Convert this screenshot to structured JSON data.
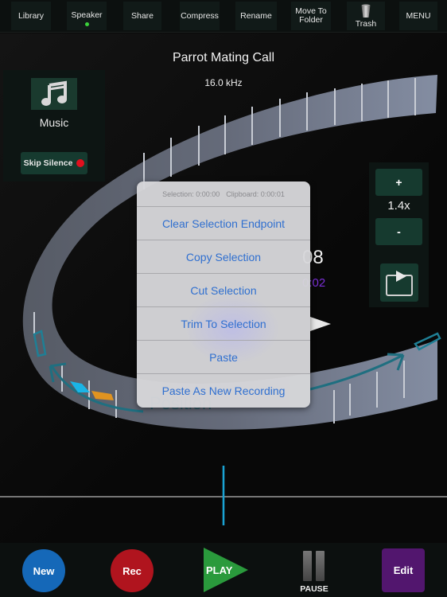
{
  "toolbar": {
    "buttons": [
      {
        "label": "Library"
      },
      {
        "label": "Speaker",
        "active_indicator": true
      },
      {
        "label": "Share"
      },
      {
        "label": "Compress"
      },
      {
        "label": "Rename"
      },
      {
        "label": "Move To Folder",
        "line1": "Move To",
        "line2": "Folder"
      },
      {
        "label": "Trash",
        "icon": "trash-icon"
      },
      {
        "label": "MENU"
      }
    ],
    "indicator_color": "#3bd13b"
  },
  "recording": {
    "title": "Parrot Mating Call",
    "sample_rate": "16.0 kHz"
  },
  "left_panel": {
    "category_icon": "music-note-icon",
    "category_label": "Music",
    "skip_silence_label": "Skip Silence",
    "skip_silence_indicator_color": "#e0101e"
  },
  "right_panel": {
    "zoom_in_label": "+",
    "zoom_level": "1.4x",
    "zoom_out_label": "-",
    "export_icon": "export-play-icon"
  },
  "clock": {
    "time_partial": "08",
    "sub_partial": "0:02"
  },
  "background_label": "Position",
  "popup": {
    "selection_label": "Selection:",
    "selection_value": "0:00:00",
    "clipboard_label": "Clipboard:",
    "clipboard_value": "0:00:01",
    "items": [
      {
        "label": "Clear Selection Endpoint"
      },
      {
        "label": "Copy Selection"
      },
      {
        "label": "Cut Selection"
      },
      {
        "label": "Trim To Selection"
      },
      {
        "label": "Paste"
      },
      {
        "label": "Paste As New Recording"
      }
    ]
  },
  "waveform": {
    "playhead_position": 0.5,
    "playhead_color": "#1aa3d4"
  },
  "bottom_bar": {
    "new_label": "New",
    "new_color": "#1568b8",
    "rec_label": "Rec",
    "rec_color": "#b0141e",
    "play_label": "PLAY",
    "play_color": "#2a9a3c",
    "pause_label": "PAUSE",
    "edit_label": "Edit",
    "edit_color": "#52166e"
  }
}
